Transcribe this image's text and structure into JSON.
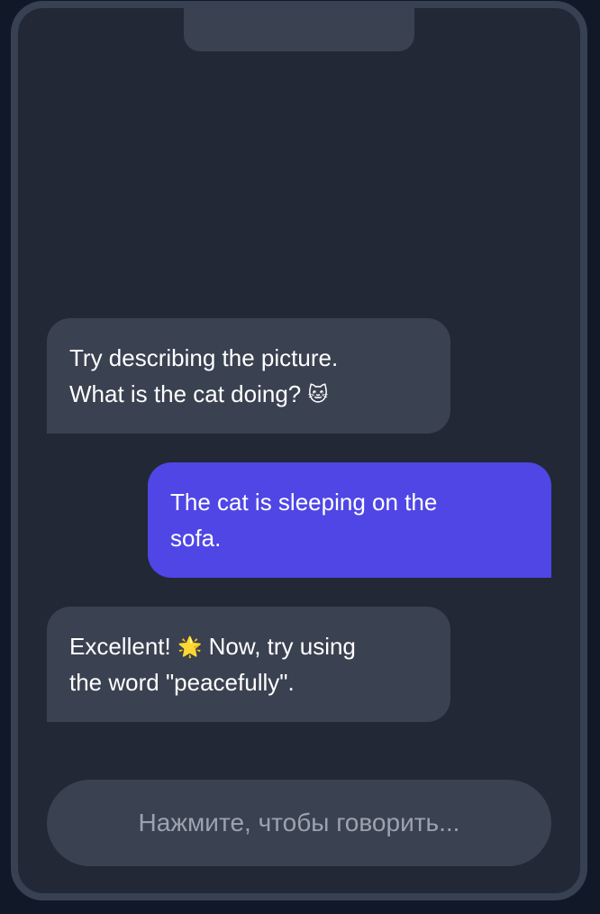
{
  "chat": {
    "messages": [
      {
        "role": "bot",
        "lines": [
          "Try describing the picture.",
          "What is the cat doing?"
        ],
        "emoji": "🐱",
        "emoji_icon": "cat-face-icon"
      },
      {
        "role": "user",
        "lines": [
          "The cat is sleeping on the",
          "sofa."
        ]
      },
      {
        "role": "bot",
        "lines": [
          "Excellent!",
          "Now, try using",
          "the word \"peacefully\"."
        ],
        "emoji": "🌟",
        "emoji_icon": "glowing-star-icon"
      }
    ]
  },
  "input": {
    "talk_label": "Нажмите, чтобы говорить..."
  },
  "colors": {
    "page_background": "#111827",
    "phone_frame": "#374151",
    "screen_background": "#222836",
    "bot_bubble": "#3a4150",
    "user_bubble": "#4f46e5",
    "text": "#ffffff",
    "placeholder_text": "#9ca3af"
  }
}
